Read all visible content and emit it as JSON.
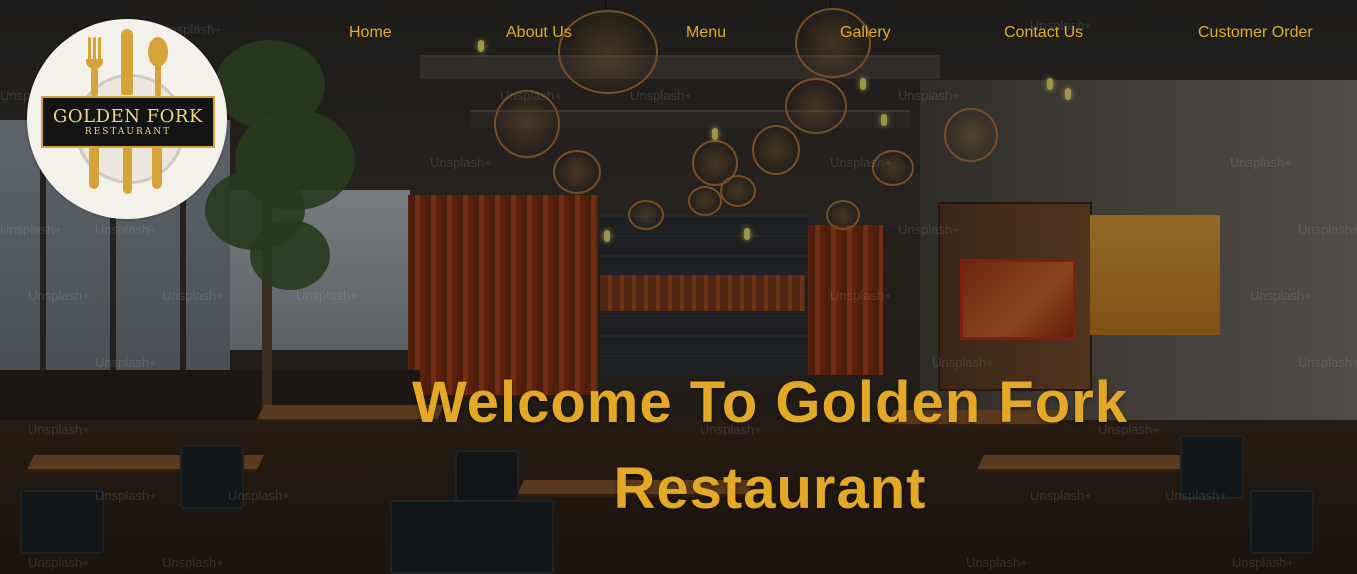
{
  "logo": {
    "brand_name": "GOLDEN FORK",
    "brand_tagline": "RESTAURANT"
  },
  "nav": {
    "items": [
      {
        "label": "Home"
      },
      {
        "label": "About Us"
      },
      {
        "label": "Menu"
      },
      {
        "label": "Gallery"
      },
      {
        "label": "Contact Us"
      },
      {
        "label": "Customer Order"
      }
    ]
  },
  "hero": {
    "headline_line1": "Welcome To Golden Fork",
    "headline_line2": "Restaurant"
  },
  "watermark": {
    "text": "Unsplash+"
  },
  "colors": {
    "accent_gold": "#e3a826",
    "nav_text": "#e1ad2a",
    "logo_bg": "#f4f1ea",
    "logo_banner": "#141414"
  },
  "icons": [
    "fork-icon",
    "knife-icon",
    "spoon-icon",
    "plate-icon"
  ]
}
